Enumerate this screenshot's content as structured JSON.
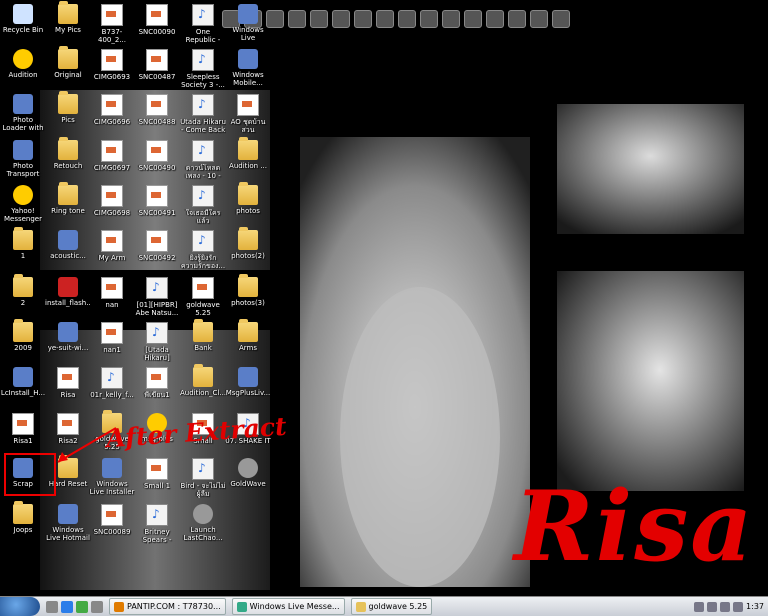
{
  "desktop": {
    "icons": [
      {
        "label": "Recycle Bin",
        "type": "recycle"
      },
      {
        "label": "My Pics",
        "type": "folder"
      },
      {
        "label": "B737-400_2...",
        "type": "doc"
      },
      {
        "label": "SNC00090",
        "type": "doc"
      },
      {
        "label": "One Republic - Apologize",
        "type": "media"
      },
      {
        "label": "Windows Live Messenger",
        "type": "app"
      },
      {
        "label": "Audition",
        "type": "face"
      },
      {
        "label": "Original",
        "type": "folder"
      },
      {
        "label": "CIMG0693",
        "type": "doc"
      },
      {
        "label": "SNC00487",
        "type": "doc"
      },
      {
        "label": "Sleepless Society 3 -...",
        "type": "media"
      },
      {
        "label": "Windows Mobile...",
        "type": "app"
      },
      {
        "label": "Photo Loader with HOT ...",
        "type": "app"
      },
      {
        "label": "Pics",
        "type": "folder"
      },
      {
        "label": "CIMG0696",
        "type": "doc"
      },
      {
        "label": "SNC00488",
        "type": "doc"
      },
      {
        "label": "Utada Hikaru - Come Back ...",
        "type": "media"
      },
      {
        "label": "AO ชุดบ้านสวน",
        "type": "doc"
      },
      {
        "label": "Photo Transport",
        "type": "app"
      },
      {
        "label": "Retouch",
        "type": "folder"
      },
      {
        "label": "CIMG0697",
        "type": "doc"
      },
      {
        "label": "SNC00490",
        "type": "doc"
      },
      {
        "label": "ดาวน์โหลดเพลง - 10 - สม...",
        "type": "media"
      },
      {
        "label": "Audition ...",
        "type": "folder"
      },
      {
        "label": "Yahoo! Messenger",
        "type": "face"
      },
      {
        "label": "Ring tone",
        "type": "folder"
      },
      {
        "label": "CIMG0698",
        "type": "doc"
      },
      {
        "label": "SNC00491",
        "type": "doc"
      },
      {
        "label": "ใจเธอมีใครแล้ว",
        "type": "media"
      },
      {
        "label": "photos",
        "type": "folder"
      },
      {
        "label": "1",
        "type": "folder"
      },
      {
        "label": "acoustic...",
        "type": "app"
      },
      {
        "label": "My Arm",
        "type": "doc"
      },
      {
        "label": "SNC00492",
        "type": "doc"
      },
      {
        "label": "ยิ่งรู้ยิ่งรัก ความรักของ...",
        "type": "media"
      },
      {
        "label": "photos(2)",
        "type": "folder"
      },
      {
        "label": "2",
        "type": "folder"
      },
      {
        "label": "install_flash...",
        "type": "red"
      },
      {
        "label": "nan",
        "type": "doc"
      },
      {
        "label": "[01][HIPBR] Abe Natsu...",
        "type": "media"
      },
      {
        "label": "goldwave 5.25",
        "type": "doc"
      },
      {
        "label": "photos(3)",
        "type": "folder"
      },
      {
        "label": "2009",
        "type": "folder"
      },
      {
        "label": "ye-suit-wi...",
        "type": "app"
      },
      {
        "label": "nan1",
        "type": "doc"
      },
      {
        "label": "[Utada Hikaru] Come Back ...",
        "type": "media"
      },
      {
        "label": "Bank",
        "type": "folder"
      },
      {
        "label": "Arms",
        "type": "folder"
      },
      {
        "label": "LcInstall_H...",
        "type": "app"
      },
      {
        "label": "Risa",
        "type": "doc"
      },
      {
        "label": "01r_kelly_f...",
        "type": "media"
      },
      {
        "label": "พี่เขียน1",
        "type": "doc"
      },
      {
        "label": "Audition_Cl...",
        "type": "folder"
      },
      {
        "label": "MsgPlusLiv...",
        "type": "app"
      },
      {
        "label": "Risa1",
        "type": "doc"
      },
      {
        "label": "Risa2",
        "type": "doc"
      },
      {
        "label": "goldwave 5.25",
        "type": "folder"
      },
      {
        "label": "msg-plus",
        "type": "face"
      },
      {
        "label": "Small",
        "type": "doc"
      },
      {
        "label": "07. SHAKE IT",
        "type": "media"
      },
      {
        "label": "Scrap",
        "type": "app"
      },
      {
        "label": "Hard Reset",
        "type": "folder"
      },
      {
        "label": "Windows Live Installer",
        "type": "app"
      },
      {
        "label": "Small 1",
        "type": "doc"
      },
      {
        "label": "Bird - จะไม่ไม่ผู้ลืม",
        "type": "media"
      },
      {
        "label": "GoldWave",
        "type": "gear"
      },
      {
        "label": "Joops",
        "type": "folder"
      },
      {
        "label": "Windows Live Hotmail",
        "type": "app"
      },
      {
        "label": "SNC00089",
        "type": "doc"
      },
      {
        "label": "Britney Spears - Unusual Y...",
        "type": "media"
      },
      {
        "label": "Launch LastChao...",
        "type": "gear"
      }
    ]
  },
  "annotation": {
    "after_extract": "After Extract",
    "wallpaper_title": "Risa"
  },
  "taskbar": {
    "tasks": [
      {
        "label": "PANTIP.COM : T78730..."
      },
      {
        "label": "Windows Live Messe..."
      },
      {
        "label": "goldwave 5.25"
      }
    ],
    "clock": "1:37"
  },
  "colors": {
    "accent_red": "#e30000",
    "background": "#000000"
  }
}
